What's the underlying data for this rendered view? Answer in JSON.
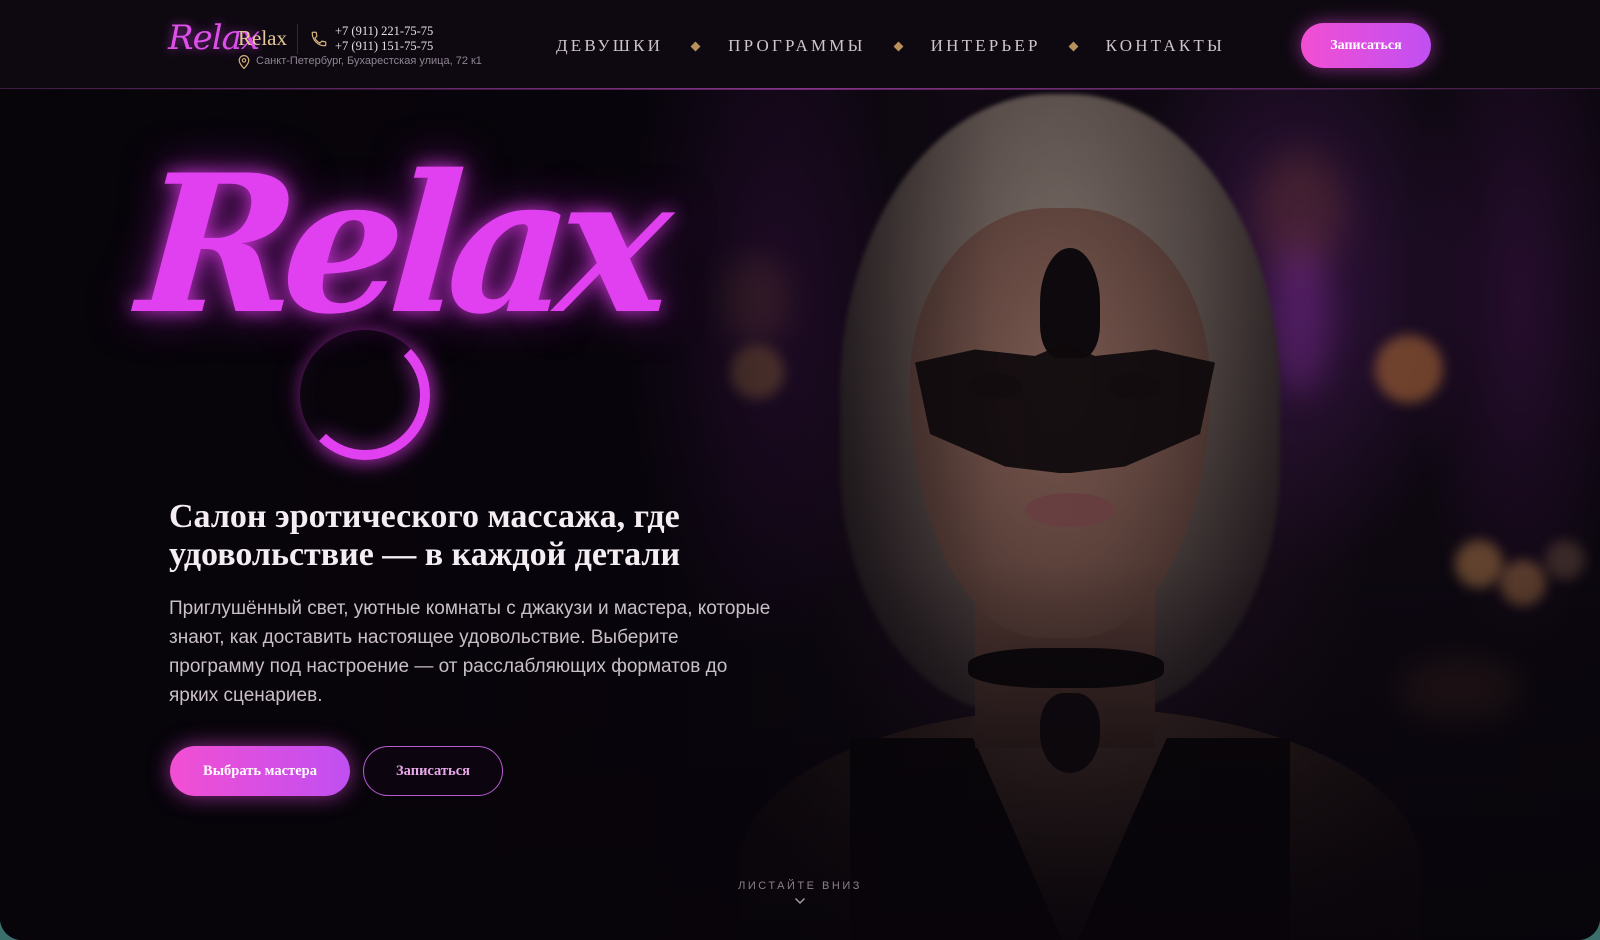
{
  "header": {
    "logo_script": "Relax",
    "logo_word": "Relax",
    "phones": [
      "+7 (911) 221-75-75",
      "+7 (911) 151-75-75"
    ],
    "address": "Санкт-Петербург, Бухарестская улица, 72 к1",
    "nav": [
      "ДЕВУШКИ",
      "ПРОГРАММЫ",
      "ИНТЕРЬЕР",
      "КОНТАКТЫ"
    ],
    "cta_label": "Записаться"
  },
  "hero": {
    "logo_text": "Relax",
    "title_line1": "Салон эротического массажа, где",
    "title_line2": "удовольствие — в каждой детали",
    "description": "Приглушённый свет, уютные комнаты с джакузи и мастера, которые знают, как доставить настоящее удовольствие. Выберите программу под настроение — от расслабляющих форматов до ярких сценариев.",
    "primary_button": "Выбрать мастера",
    "secondary_button": "Записаться"
  },
  "scroll_hint": "ЛИСТАЙТЕ ВНИЗ",
  "colors": {
    "accent_pink": "#f24fd2",
    "accent_violet": "#c04ff2",
    "neon_logo": "#e040f0",
    "gold": "#b9905c",
    "background": "#07040a"
  },
  "icons": {
    "phone": "phone-icon",
    "pin": "map-pin-icon",
    "scroll": "chevron-down-icon"
  }
}
